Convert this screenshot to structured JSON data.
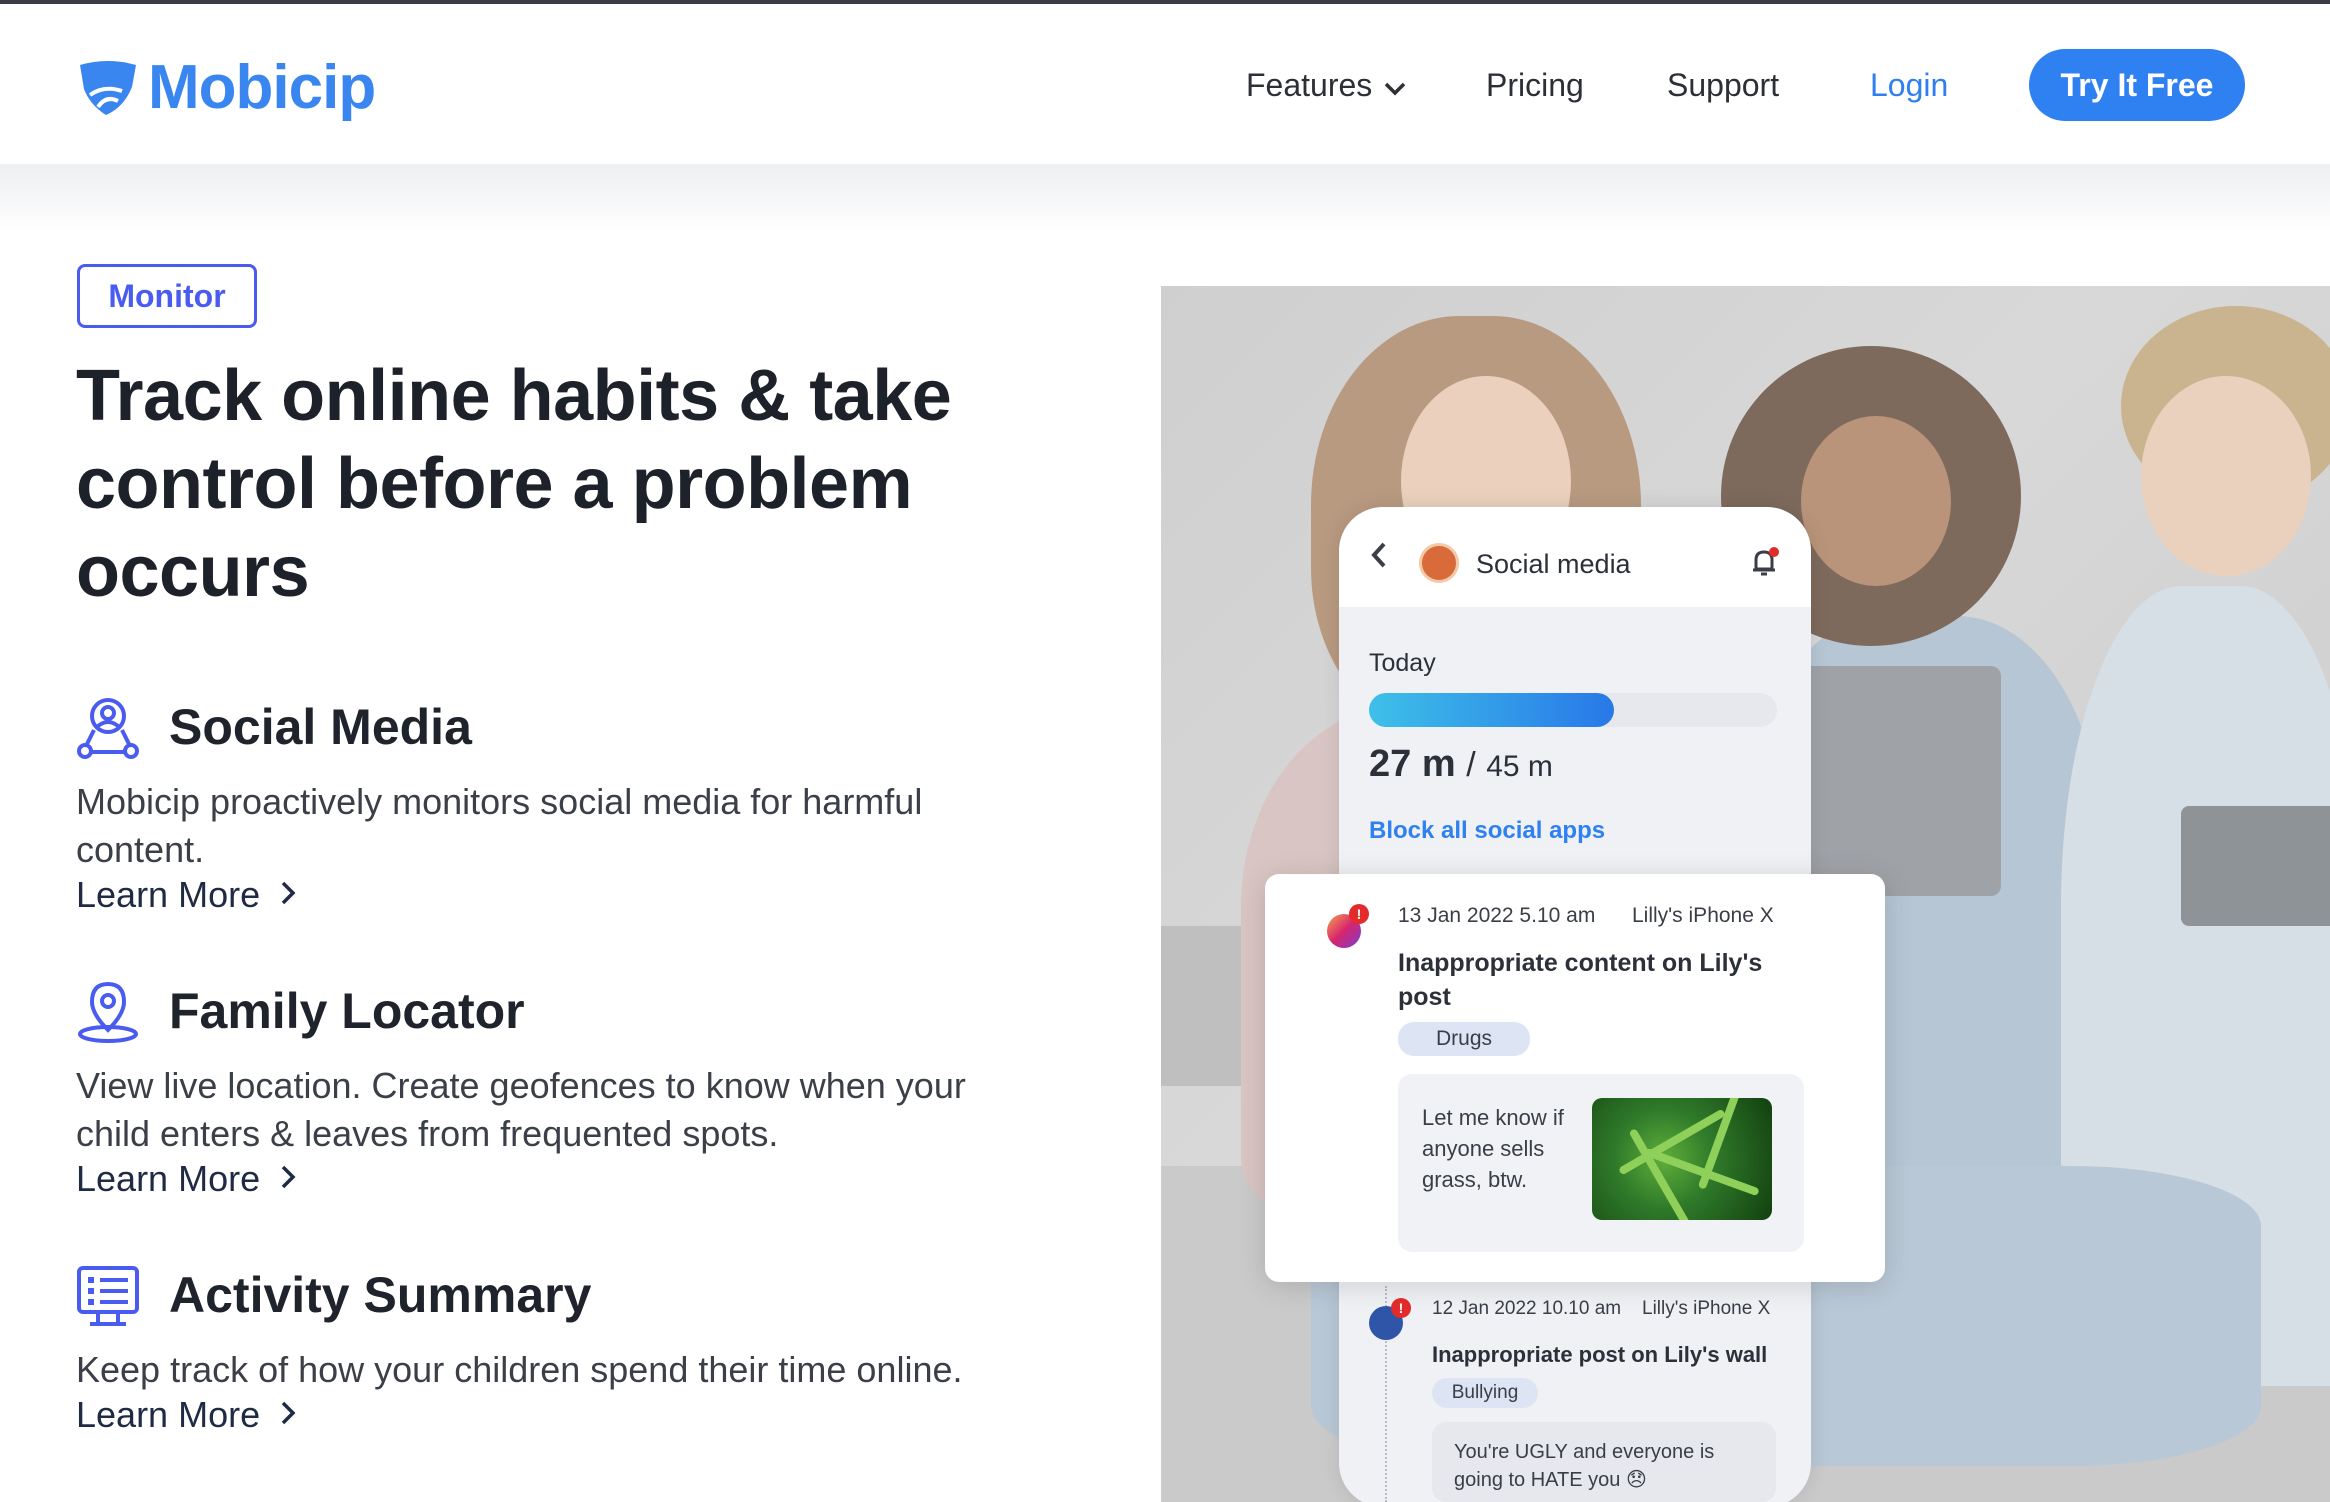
{
  "header": {
    "logo_text": "Mobicip",
    "nav": {
      "features": "Features",
      "pricing": "Pricing",
      "support": "Support",
      "login": "Login"
    },
    "cta": "Try It Free"
  },
  "hero": {
    "badge": "Monitor",
    "headline": "Track online habits & take control before a problem occurs"
  },
  "features": [
    {
      "title": "Social Media",
      "description": "Mobicip proactively monitors social media for harmful content.",
      "link": "Learn More",
      "icon": "social-media-icon"
    },
    {
      "title": "Family Locator",
      "description": "View live location. Create geofences to know when your child enters & leaves from frequented spots.",
      "link": "Learn More",
      "icon": "location-pin-icon"
    },
    {
      "title": "Activity Summary",
      "description": "Keep track of how your children spend their time online.",
      "link": "Learn More",
      "icon": "activity-list-icon"
    }
  ],
  "phone": {
    "title": "Social media",
    "today_label": "Today",
    "usage_used": "27 m",
    "usage_separator": "/",
    "usage_limit": "45 m",
    "usage_fraction": 0.6,
    "block_link": "Block all social apps"
  },
  "alerts": [
    {
      "date": "13 Jan 2022  5.10 am",
      "device": "Lilly's iPhone X",
      "title": "Inappropriate content on Lily's post",
      "tag": "Drugs",
      "message": "Let me know if anyone sells grass, btw.",
      "platform_icon": "instagram-icon"
    },
    {
      "date": "12 Jan 2022 10.10 am",
      "device": "Lilly's iPhone X",
      "title": "Inappropriate post on Lily's wall",
      "tag": "Bullying",
      "message": "You're UGLY and everyone is going to HATE you 😞",
      "platform_icon": "facebook-icon"
    }
  ],
  "colors": {
    "brand": "#3a86f1",
    "accent": "#4a5cf0",
    "cta": "#2f80f0",
    "alert": "#e42b2b"
  }
}
